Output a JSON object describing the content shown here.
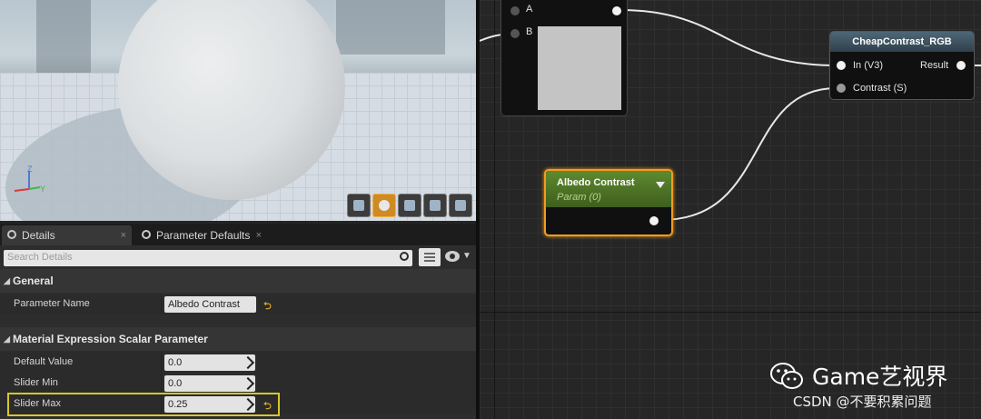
{
  "tabs": [
    {
      "label": "Details",
      "close": "×"
    },
    {
      "label": "Parameter Defaults",
      "close": "×"
    }
  ],
  "search": {
    "placeholder": "Search Details"
  },
  "sections": {
    "general": "General",
    "scalar": "Material Expression Scalar Parameter"
  },
  "properties": {
    "parameter_name": {
      "label": "Parameter Name",
      "value": "Albedo Contrast"
    },
    "default_value": {
      "label": "Default Value",
      "value": "0.0"
    },
    "slider_min": {
      "label": "Slider Min",
      "value": "0.0"
    },
    "slider_max": {
      "label": "Slider Max",
      "value": "0.25"
    }
  },
  "reset_glyph": "⮌",
  "graph": {
    "top_node": {
      "pin_a": "A",
      "pin_b": "B"
    },
    "cheap_node": {
      "title": "CheapContrast_RGB",
      "in": "In (V3)",
      "contrast": "Contrast (S)",
      "result": "Result"
    },
    "albedo_node": {
      "title": "Albedo Contrast",
      "subtitle": "Param (0)"
    }
  },
  "viewport": {
    "axis_z": "Z",
    "axis_y": "Y"
  },
  "watermark": {
    "title": "Game艺视界",
    "subtitle": "CSDN @不要积累问题"
  }
}
